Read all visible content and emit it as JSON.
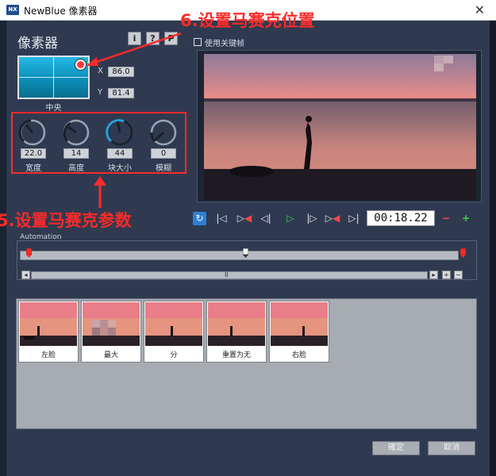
{
  "window": {
    "logo": "NX",
    "title": "NewBlue 像素器",
    "close": "✕"
  },
  "panel": {
    "heading": "像素器",
    "btn_info": "i",
    "btn_help": "?",
    "btn_preset": "P"
  },
  "position": {
    "caption": "中央",
    "x_label": "X",
    "x_value": "86.0",
    "y_label": "Y",
    "y_value": "81.4"
  },
  "params": [
    {
      "label": "宽度",
      "value": "22.0",
      "level": 0.22
    },
    {
      "label": "高度",
      "value": "14",
      "level": 0.14
    },
    {
      "label": "块大小",
      "value": "44",
      "level": 0.44
    },
    {
      "label": "模糊",
      "value": "0",
      "level": 0.0
    }
  ],
  "annotations": {
    "position_note": "6.设置马赛克位置",
    "params_note": "5.设置马赛克参数"
  },
  "keyframe": {
    "label": "使用关键帧",
    "checked": false
  },
  "playback": {
    "buttons": [
      "loop-icon",
      "go-start-icon",
      "prev-keyframe-icon",
      "step-back-icon",
      "play-icon",
      "step-forward-icon",
      "next-keyframe-icon",
      "go-end-icon"
    ],
    "timecode": "00:18.22"
  },
  "automation": {
    "label": "Automation",
    "playhead": 0.5,
    "zoom_in": "+",
    "zoom_out": "−",
    "thumb": "II"
  },
  "presets": [
    {
      "name": "左脸"
    },
    {
      "name": "最大"
    },
    {
      "name": "分"
    },
    {
      "name": "重置为无"
    },
    {
      "name": "右脸"
    }
  ],
  "buttons": {
    "ok": "確定",
    "cancel": "取消"
  },
  "colors": {
    "annotation": "#ff2a2a",
    "panel": "#2f3a50",
    "accent": "#2aa0d8"
  }
}
